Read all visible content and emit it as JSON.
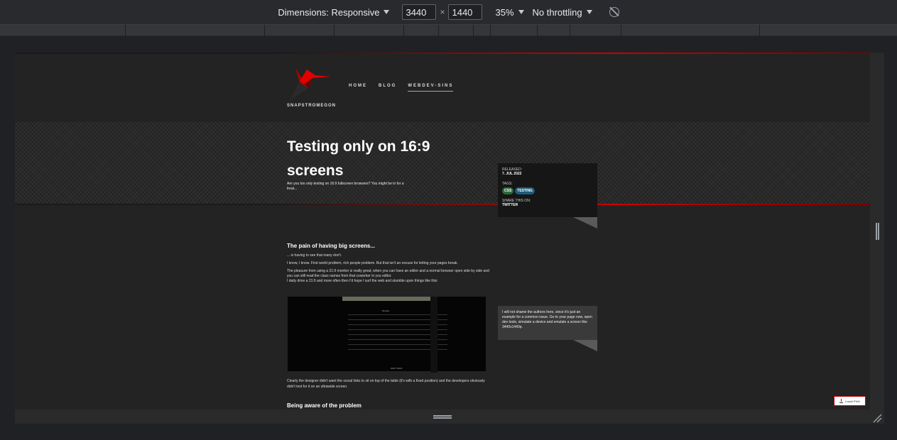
{
  "toolbar": {
    "dimensions_label": "Dimensions: Responsive",
    "width_value": "3440",
    "times": "×",
    "height_value": "1440",
    "zoom": "35%",
    "throttling": "No throttling",
    "rotate_icon": "rotate-icon"
  },
  "site": {
    "brand": "SNAPSTROMEGON",
    "nav": [
      "HOME",
      "BLOG",
      "WEBDEV-SINS"
    ],
    "active_nav": "WEBDEV-SINS",
    "title": "Testing only on 16:9 screens",
    "subtitle": "Are you too only testing on 16:9 fullscreen browsers? You might be in for a treat...",
    "info": {
      "released_label": "RELEASED:",
      "released_value": "7. JUL 2022",
      "tags_label": "TAGS:",
      "tags": [
        "CSS",
        "TESTING"
      ],
      "share_label": "SHARE THIS ON:",
      "share_value": "TWITTER"
    },
    "section1_heading": "The pain of having big screens...",
    "p1": "... is having to see that many don't.",
    "p2": "I know, I know. First world problem, rich people problem. But that isn't an excuse for letting your pages break.",
    "p3": "The pleasure from using a 21:9 monitor is really great, when you can have an editor and a normal browser open side by side and you can still read the class names from that coworker in you editor.",
    "p4": "I daily drive a 21:9 and more often then I'd hope I surf the web and stumble upon things like this:",
    "screenshot_title": "Results",
    "screenshot_footer": "2022 ©2022",
    "note": "I will not shame the authors here, since it's just an example for a common issue. Go to your page now, open dev tools, simulate a device and emulate a screen like 3440x1440p.",
    "p5": "Clearly the designer didn't want the social links to sit on top of the table (it's with a fixed position) and the developers obviously didn't test for it on an ultrawide screen.",
    "section2_heading": "Being aware of the problem",
    "pwa_button": "Install PWA"
  },
  "colors": {
    "accent_red": "#cc0000",
    "tag_css": "#2e6b3a",
    "tag_testing": "#1d5c7a"
  }
}
